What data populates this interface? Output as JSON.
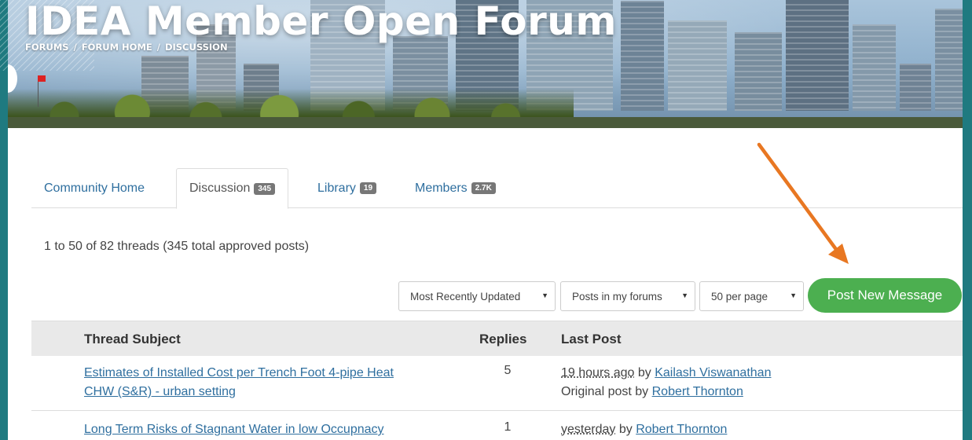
{
  "banner": {
    "title": "IDEA Member Open Forum",
    "breadcrumb": [
      "FORUMS",
      "FORUM HOME",
      "DISCUSSION"
    ]
  },
  "tabs": [
    {
      "label": "Community Home",
      "badge": ""
    },
    {
      "label": "Discussion",
      "badge": "345"
    },
    {
      "label": "Library",
      "badge": "19"
    },
    {
      "label": "Members",
      "badge": "2.7K"
    }
  ],
  "summary": "1 to 50 of 82 threads (345 total approved posts)",
  "controls": {
    "sort": "Most Recently Updated",
    "scope": "Posts in my forums",
    "per_page": "50 per page",
    "post_button": "Post New Message"
  },
  "table": {
    "headers": {
      "subject": "Thread Subject",
      "replies": "Replies",
      "last_post": "Last Post"
    },
    "rows": [
      {
        "subject_line1": "Estimates of Installed Cost per Trench Foot 4-pipe Heat",
        "subject_line2": "CHW (S&R) - urban setting",
        "replies": "5",
        "time": "19 hours ago",
        "by": "by",
        "author": "Kailash Viswanathan",
        "original_prefix": "Original post by",
        "original_author": "Robert Thornton"
      },
      {
        "subject_line1": "Long Term Risks of Stagnant Water in low Occupnacy",
        "subject_line2": "",
        "replies": "1",
        "time": "yesterday",
        "by": "by",
        "author": "Robert Thornton",
        "original_prefix": "",
        "original_author": ""
      }
    ]
  },
  "colors": {
    "accent_green": "#4caf50",
    "link_blue": "#2f6f9f",
    "arrow_orange": "#e87722",
    "frame_teal": "#1f7a80"
  }
}
